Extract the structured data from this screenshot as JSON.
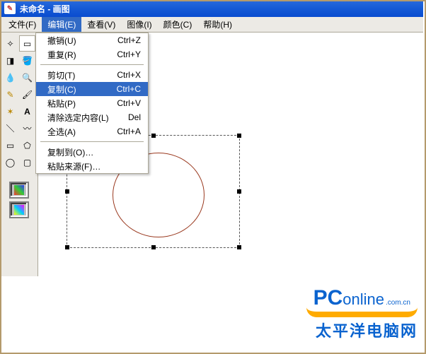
{
  "window_title": "未命名 - 画图",
  "menubar": [
    {
      "label": "文件(F)"
    },
    {
      "label": "编辑(E)"
    },
    {
      "label": "查看(V)"
    },
    {
      "label": "图像(I)"
    },
    {
      "label": "颜色(C)"
    },
    {
      "label": "帮助(H)"
    }
  ],
  "edit_menu": {
    "undo": {
      "label": "撤销(U)",
      "sc": "Ctrl+Z"
    },
    "redo": {
      "label": "重复(R)",
      "sc": "Ctrl+Y"
    },
    "cut": {
      "label": "剪切(T)",
      "sc": "Ctrl+X"
    },
    "copy": {
      "label": "复制(C)",
      "sc": "Ctrl+C"
    },
    "paste": {
      "label": "粘贴(P)",
      "sc": "Ctrl+V"
    },
    "clear": {
      "label": "清除选定内容(L)",
      "sc": "Del"
    },
    "selectall": {
      "label": "全选(A)",
      "sc": "Ctrl+A"
    },
    "copyto": {
      "label": "复制到(O)…",
      "sc": ""
    },
    "pastefrom": {
      "label": "粘贴来源(F)…",
      "sc": ""
    }
  },
  "tools": {
    "freeform_select": "freeform-select-icon",
    "rect_select": "rect-select-icon",
    "eraser": "eraser-icon",
    "fill": "fill-icon",
    "picker": "picker-icon",
    "zoom": "zoom-icon",
    "pencil": "pencil-icon",
    "brush": "brush-icon",
    "airbrush": "airbrush-icon",
    "text": "text-icon",
    "line": "line-icon",
    "curve": "curve-icon",
    "rect": "rect-icon",
    "polygon": "polygon-icon",
    "ellipse": "ellipse-icon",
    "roundrect": "roundrect-icon"
  },
  "watermark": {
    "brand_p": "PC",
    "brand_o": "online",
    "brand_ext": ".com.cn",
    "cn": "太平洋电脑网"
  }
}
